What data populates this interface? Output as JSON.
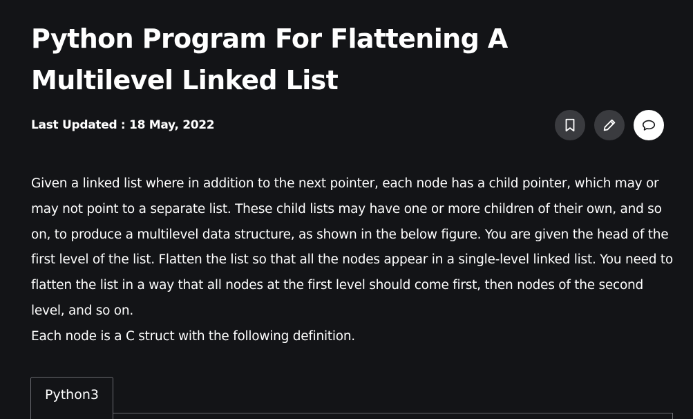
{
  "article": {
    "title": "Python Program For Flattening A Multilevel Linked List",
    "last_updated_label": "Last Updated : ",
    "last_updated_date": "18 May, 2022",
    "paragraphs": [
      "Given a linked list where in addition to the next pointer, each node has a child pointer, which may or may not point to a separate list. These child lists may have one or more children of their own, and so on, to produce a multilevel data structure, as shown in the below figure. You are given the head of the first level of the list. Flatten the list so that all the nodes appear in a single-level linked list. You need to flatten the list in a way that all nodes at the first level should come first, then nodes of the second level, and so on.",
      "Each node is a C struct with the following definition."
    ]
  },
  "actions": [
    {
      "name": "bookmark",
      "icon": "bookmark-icon"
    },
    {
      "name": "edit",
      "icon": "pencil-icon"
    },
    {
      "name": "discuss",
      "icon": "chat-bubbles-icon"
    }
  ],
  "code_tabs": [
    {
      "label": "Python3",
      "active": true
    }
  ],
  "colors": {
    "background": "#131417",
    "text": "#ffffff",
    "button_bg": "#3a3b3f",
    "button_active_bg": "#ffffff",
    "border": "#6b6d72"
  }
}
